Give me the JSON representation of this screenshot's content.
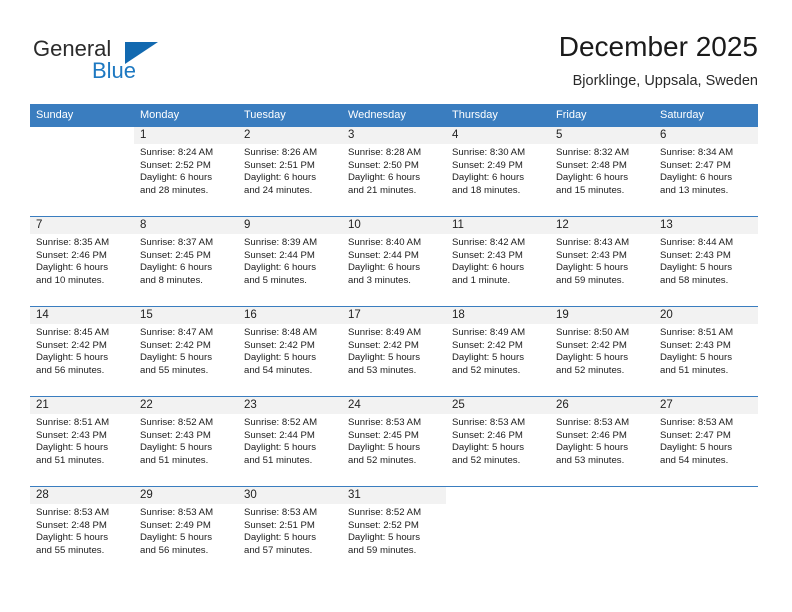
{
  "brand": {
    "word1": "General",
    "word2": "Blue",
    "accent_color": "#1269b0"
  },
  "header": {
    "title": "December 2025",
    "subtitle": "Bjorklinge, Uppsala, Sweden"
  },
  "calendar": {
    "header_color": "#3a7dbf",
    "weekday_headers": [
      "Sunday",
      "Monday",
      "Tuesday",
      "Wednesday",
      "Thursday",
      "Friday",
      "Saturday"
    ],
    "weeks": [
      [
        {
          "day": "",
          "lines": []
        },
        {
          "day": "1",
          "lines": [
            "Sunrise: 8:24 AM",
            "Sunset: 2:52 PM",
            "Daylight: 6 hours",
            "and 28 minutes."
          ]
        },
        {
          "day": "2",
          "lines": [
            "Sunrise: 8:26 AM",
            "Sunset: 2:51 PM",
            "Daylight: 6 hours",
            "and 24 minutes."
          ]
        },
        {
          "day": "3",
          "lines": [
            "Sunrise: 8:28 AM",
            "Sunset: 2:50 PM",
            "Daylight: 6 hours",
            "and 21 minutes."
          ]
        },
        {
          "day": "4",
          "lines": [
            "Sunrise: 8:30 AM",
            "Sunset: 2:49 PM",
            "Daylight: 6 hours",
            "and 18 minutes."
          ]
        },
        {
          "day": "5",
          "lines": [
            "Sunrise: 8:32 AM",
            "Sunset: 2:48 PM",
            "Daylight: 6 hours",
            "and 15 minutes."
          ]
        },
        {
          "day": "6",
          "lines": [
            "Sunrise: 8:34 AM",
            "Sunset: 2:47 PM",
            "Daylight: 6 hours",
            "and 13 minutes."
          ]
        }
      ],
      [
        {
          "day": "7",
          "lines": [
            "Sunrise: 8:35 AM",
            "Sunset: 2:46 PM",
            "Daylight: 6 hours",
            "and 10 minutes."
          ]
        },
        {
          "day": "8",
          "lines": [
            "Sunrise: 8:37 AM",
            "Sunset: 2:45 PM",
            "Daylight: 6 hours",
            "and 8 minutes."
          ]
        },
        {
          "day": "9",
          "lines": [
            "Sunrise: 8:39 AM",
            "Sunset: 2:44 PM",
            "Daylight: 6 hours",
            "and 5 minutes."
          ]
        },
        {
          "day": "10",
          "lines": [
            "Sunrise: 8:40 AM",
            "Sunset: 2:44 PM",
            "Daylight: 6 hours",
            "and 3 minutes."
          ]
        },
        {
          "day": "11",
          "lines": [
            "Sunrise: 8:42 AM",
            "Sunset: 2:43 PM",
            "Daylight: 6 hours",
            "and 1 minute."
          ]
        },
        {
          "day": "12",
          "lines": [
            "Sunrise: 8:43 AM",
            "Sunset: 2:43 PM",
            "Daylight: 5 hours",
            "and 59 minutes."
          ]
        },
        {
          "day": "13",
          "lines": [
            "Sunrise: 8:44 AM",
            "Sunset: 2:43 PM",
            "Daylight: 5 hours",
            "and 58 minutes."
          ]
        }
      ],
      [
        {
          "day": "14",
          "lines": [
            "Sunrise: 8:45 AM",
            "Sunset: 2:42 PM",
            "Daylight: 5 hours",
            "and 56 minutes."
          ]
        },
        {
          "day": "15",
          "lines": [
            "Sunrise: 8:47 AM",
            "Sunset: 2:42 PM",
            "Daylight: 5 hours",
            "and 55 minutes."
          ]
        },
        {
          "day": "16",
          "lines": [
            "Sunrise: 8:48 AM",
            "Sunset: 2:42 PM",
            "Daylight: 5 hours",
            "and 54 minutes."
          ]
        },
        {
          "day": "17",
          "lines": [
            "Sunrise: 8:49 AM",
            "Sunset: 2:42 PM",
            "Daylight: 5 hours",
            "and 53 minutes."
          ]
        },
        {
          "day": "18",
          "lines": [
            "Sunrise: 8:49 AM",
            "Sunset: 2:42 PM",
            "Daylight: 5 hours",
            "and 52 minutes."
          ]
        },
        {
          "day": "19",
          "lines": [
            "Sunrise: 8:50 AM",
            "Sunset: 2:42 PM",
            "Daylight: 5 hours",
            "and 52 minutes."
          ]
        },
        {
          "day": "20",
          "lines": [
            "Sunrise: 8:51 AM",
            "Sunset: 2:43 PM",
            "Daylight: 5 hours",
            "and 51 minutes."
          ]
        }
      ],
      [
        {
          "day": "21",
          "lines": [
            "Sunrise: 8:51 AM",
            "Sunset: 2:43 PM",
            "Daylight: 5 hours",
            "and 51 minutes."
          ]
        },
        {
          "day": "22",
          "lines": [
            "Sunrise: 8:52 AM",
            "Sunset: 2:43 PM",
            "Daylight: 5 hours",
            "and 51 minutes."
          ]
        },
        {
          "day": "23",
          "lines": [
            "Sunrise: 8:52 AM",
            "Sunset: 2:44 PM",
            "Daylight: 5 hours",
            "and 51 minutes."
          ]
        },
        {
          "day": "24",
          "lines": [
            "Sunrise: 8:53 AM",
            "Sunset: 2:45 PM",
            "Daylight: 5 hours",
            "and 52 minutes."
          ]
        },
        {
          "day": "25",
          "lines": [
            "Sunrise: 8:53 AM",
            "Sunset: 2:46 PM",
            "Daylight: 5 hours",
            "and 52 minutes."
          ]
        },
        {
          "day": "26",
          "lines": [
            "Sunrise: 8:53 AM",
            "Sunset: 2:46 PM",
            "Daylight: 5 hours",
            "and 53 minutes."
          ]
        },
        {
          "day": "27",
          "lines": [
            "Sunrise: 8:53 AM",
            "Sunset: 2:47 PM",
            "Daylight: 5 hours",
            "and 54 minutes."
          ]
        }
      ],
      [
        {
          "day": "28",
          "lines": [
            "Sunrise: 8:53 AM",
            "Sunset: 2:48 PM",
            "Daylight: 5 hours",
            "and 55 minutes."
          ]
        },
        {
          "day": "29",
          "lines": [
            "Sunrise: 8:53 AM",
            "Sunset: 2:49 PM",
            "Daylight: 5 hours",
            "and 56 minutes."
          ]
        },
        {
          "day": "30",
          "lines": [
            "Sunrise: 8:53 AM",
            "Sunset: 2:51 PM",
            "Daylight: 5 hours",
            "and 57 minutes."
          ]
        },
        {
          "day": "31",
          "lines": [
            "Sunrise: 8:52 AM",
            "Sunset: 2:52 PM",
            "Daylight: 5 hours",
            "and 59 minutes."
          ]
        },
        {
          "day": "",
          "lines": []
        },
        {
          "day": "",
          "lines": []
        },
        {
          "day": "",
          "lines": []
        }
      ]
    ]
  }
}
